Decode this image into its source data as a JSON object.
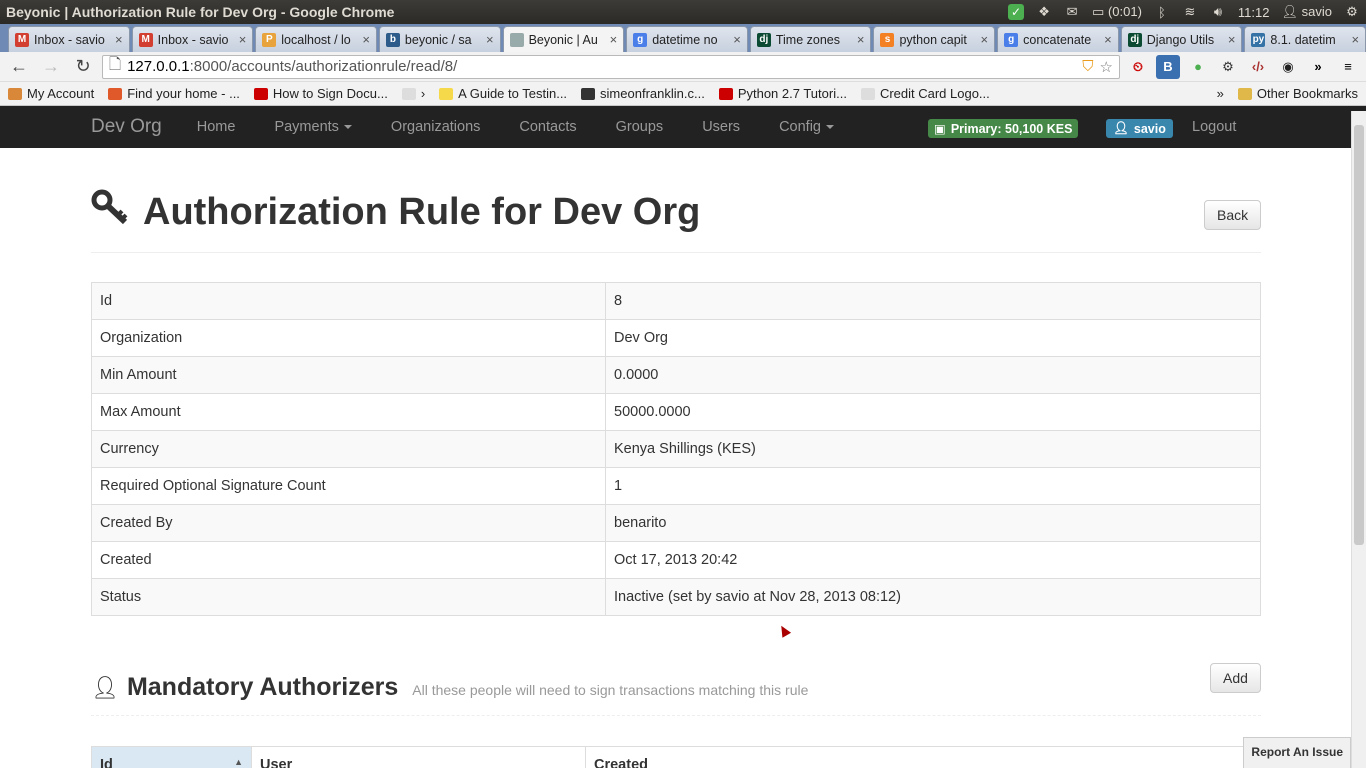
{
  "os": {
    "window_title": "Beyonic | Authorization Rule for Dev Org - Google Chrome",
    "battery": "(0:01)",
    "time": "11:12",
    "user": "savio"
  },
  "tabs": [
    {
      "label": "Inbox - savio",
      "icon": "gmail-icon",
      "color": "#d23f31",
      "glyph": "M"
    },
    {
      "label": "Inbox - savio",
      "icon": "gmail-icon",
      "color": "#d23f31",
      "glyph": "M"
    },
    {
      "label": "localhost / lo",
      "icon": "phpmyadmin-icon",
      "color": "#e8a33d",
      "glyph": "P"
    },
    {
      "label": "beyonic / sa",
      "icon": "github-icon",
      "color": "#2d5c8a",
      "glyph": "b"
    },
    {
      "label": "Beyonic | Au",
      "icon": "page-icon",
      "color": "#9aa",
      "glyph": ""
    },
    {
      "label": "datetime no",
      "icon": "google-icon",
      "color": "#4a7ee8",
      "glyph": "g"
    },
    {
      "label": "Time zones",
      "icon": "django-icon",
      "color": "#0c4b33",
      "glyph": "dj"
    },
    {
      "label": "python capit",
      "icon": "stackoverflow-icon",
      "color": "#f48024",
      "glyph": "s"
    },
    {
      "label": "concatenate",
      "icon": "google-icon",
      "color": "#4a7ee8",
      "glyph": "g"
    },
    {
      "label": "Django Utils",
      "icon": "django-icon",
      "color": "#0c4b33",
      "glyph": "dj"
    },
    {
      "label": "8.1. datetim",
      "icon": "python-icon",
      "color": "#3572a5",
      "glyph": "py"
    }
  ],
  "active_tab": 4,
  "address": {
    "host": "127.0.0.1",
    "path": ":8000/accounts/authorizationrule/read/8/"
  },
  "bookmarks": [
    {
      "label": "My Account",
      "color": "#d9883a"
    },
    {
      "label": "Find your home - ...",
      "color": "#e0592a"
    },
    {
      "label": "How to Sign Docu...",
      "color": "#c00"
    },
    {
      "label": "›",
      "color": "#ddd"
    },
    {
      "label": "A Guide to Testin...",
      "color": "#f5d94a"
    },
    {
      "label": "simeonfranklin.c...",
      "color": "#333"
    },
    {
      "label": "Python 2.7 Tutori...",
      "color": "#c00"
    },
    {
      "label": "Credit Card Logo...",
      "color": "#ddd"
    }
  ],
  "bookmarks_more": "»",
  "other_bookmarks": "Other Bookmarks",
  "app": {
    "brand": "Dev Org",
    "nav": [
      "Home",
      "Payments",
      "Organizations",
      "Contacts",
      "Groups",
      "Users",
      "Config"
    ],
    "balance": "Primary: 50,100  KES",
    "user": "savio",
    "logout": "Logout"
  },
  "page": {
    "title": "Authorization Rule for Dev Org",
    "back_label": "Back"
  },
  "details": [
    {
      "key": "Id",
      "value": "8"
    },
    {
      "key": "Organization",
      "value": "Dev Org"
    },
    {
      "key": "Min Amount",
      "value": "0.0000"
    },
    {
      "key": "Max Amount",
      "value": "50000.0000"
    },
    {
      "key": "Currency",
      "value": "Kenya Shillings (KES)"
    },
    {
      "key": "Required Optional Signature Count",
      "value": "1"
    },
    {
      "key": "Created By",
      "value": "benarito"
    },
    {
      "key": "Created",
      "value": "Oct 17, 2013 20:42"
    },
    {
      "key": "Status",
      "value": "Inactive (set by savio at Nov 28, 2013 08:12)"
    }
  ],
  "authorizers": {
    "title": "Mandatory Authorizers",
    "subtitle": "All these people will need to sign transactions matching this rule",
    "add_label": "Add",
    "columns": [
      "Id",
      "User",
      "Created"
    ]
  },
  "report_issue": "Report An Issue"
}
